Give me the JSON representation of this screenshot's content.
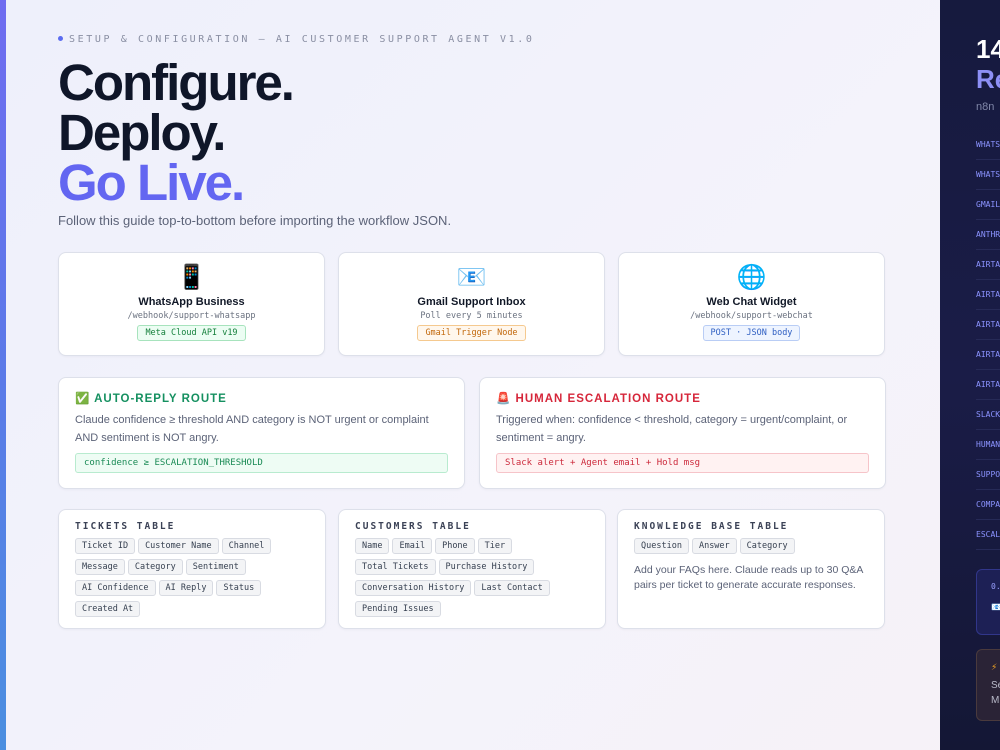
{
  "header": {
    "eyebrow": "SETUP & CONFIGURATION — AI CUSTOMER SUPPORT AGENT V1.0",
    "headline": [
      "Configure.",
      "Deploy.",
      "Go Live."
    ],
    "subtitle": "Follow this guide top-to-bottom before importing the workflow JSON.",
    "accent_color": "#6366f1"
  },
  "sources": [
    {
      "icon": "mobile-phone-icon",
      "glyph": "📱",
      "title": "WhatsApp Business",
      "path": "/webhook/support-whatsapp",
      "tag": "Meta Cloud API v19",
      "tag_color": "green"
    },
    {
      "icon": "email-icon",
      "glyph": "📧",
      "title": "Gmail Support Inbox",
      "path": "Poll every 5 minutes",
      "tag": "Gmail Trigger Node",
      "tag_color": "orange"
    },
    {
      "icon": "globe-icon",
      "glyph": "🌐",
      "title": "Web Chat Widget",
      "path": "/webhook/support-webchat",
      "tag": "POST · JSON body",
      "tag_color": "blue"
    }
  ],
  "routes": {
    "auto": {
      "icon": "✅",
      "title": "AUTO-REPLY ROUTE",
      "desc": "Claude confidence ≥ threshold AND category is NOT urgent or complaint AND sentiment is NOT angry.",
      "code": "confidence ≥ ESCALATION_THRESHOLD"
    },
    "human": {
      "icon": "🚨",
      "title": "HUMAN ESCALATION ROUTE",
      "desc": "Triggered when: confidence < threshold, category = urgent/complaint, or sentiment = angry.",
      "code": "Slack alert + Agent email + Hold msg"
    }
  },
  "tables": {
    "tickets": {
      "title": "TICKETS TABLE",
      "fields": [
        "Ticket ID",
        "Customer Name",
        "Channel",
        "Message",
        "Category",
        "Sentiment",
        "AI Confidence",
        "AI Reply",
        "Status",
        "Created At"
      ]
    },
    "customers": {
      "title": "CUSTOMERS TABLE",
      "fields": [
        "Name",
        "Email",
        "Phone",
        "Tier",
        "Total Tickets",
        "Purchase History",
        "Conversation History",
        "Last Contact",
        "Pending Issues"
      ]
    },
    "kb": {
      "title": "KNOWLEDGE BASE TABLE",
      "fields": [
        "Question",
        "Answer",
        "Category"
      ],
      "text": "Add your FAQs here. Claude reads up to 30 Q&A pairs per ticket to generate accurate responses."
    }
  },
  "sidebar": {
    "count": "14",
    "sub": "Re",
    "caption": "n8n",
    "items": [
      "WHATS",
      "WHATS",
      "GMAIL",
      "ANTHR",
      "AIRTA",
      "AIRTA",
      "AIRTA",
      "AIRTA",
      "AIRTA",
      "SLACK",
      "HUMAN",
      "SUPPO",
      "COMPA",
      "ESCAL"
    ],
    "box1_title": "0.",
    "box1_icon": "📧",
    "box2_title": "⚡",
    "box2_line1": "Se",
    "box2_line2": "M"
  }
}
